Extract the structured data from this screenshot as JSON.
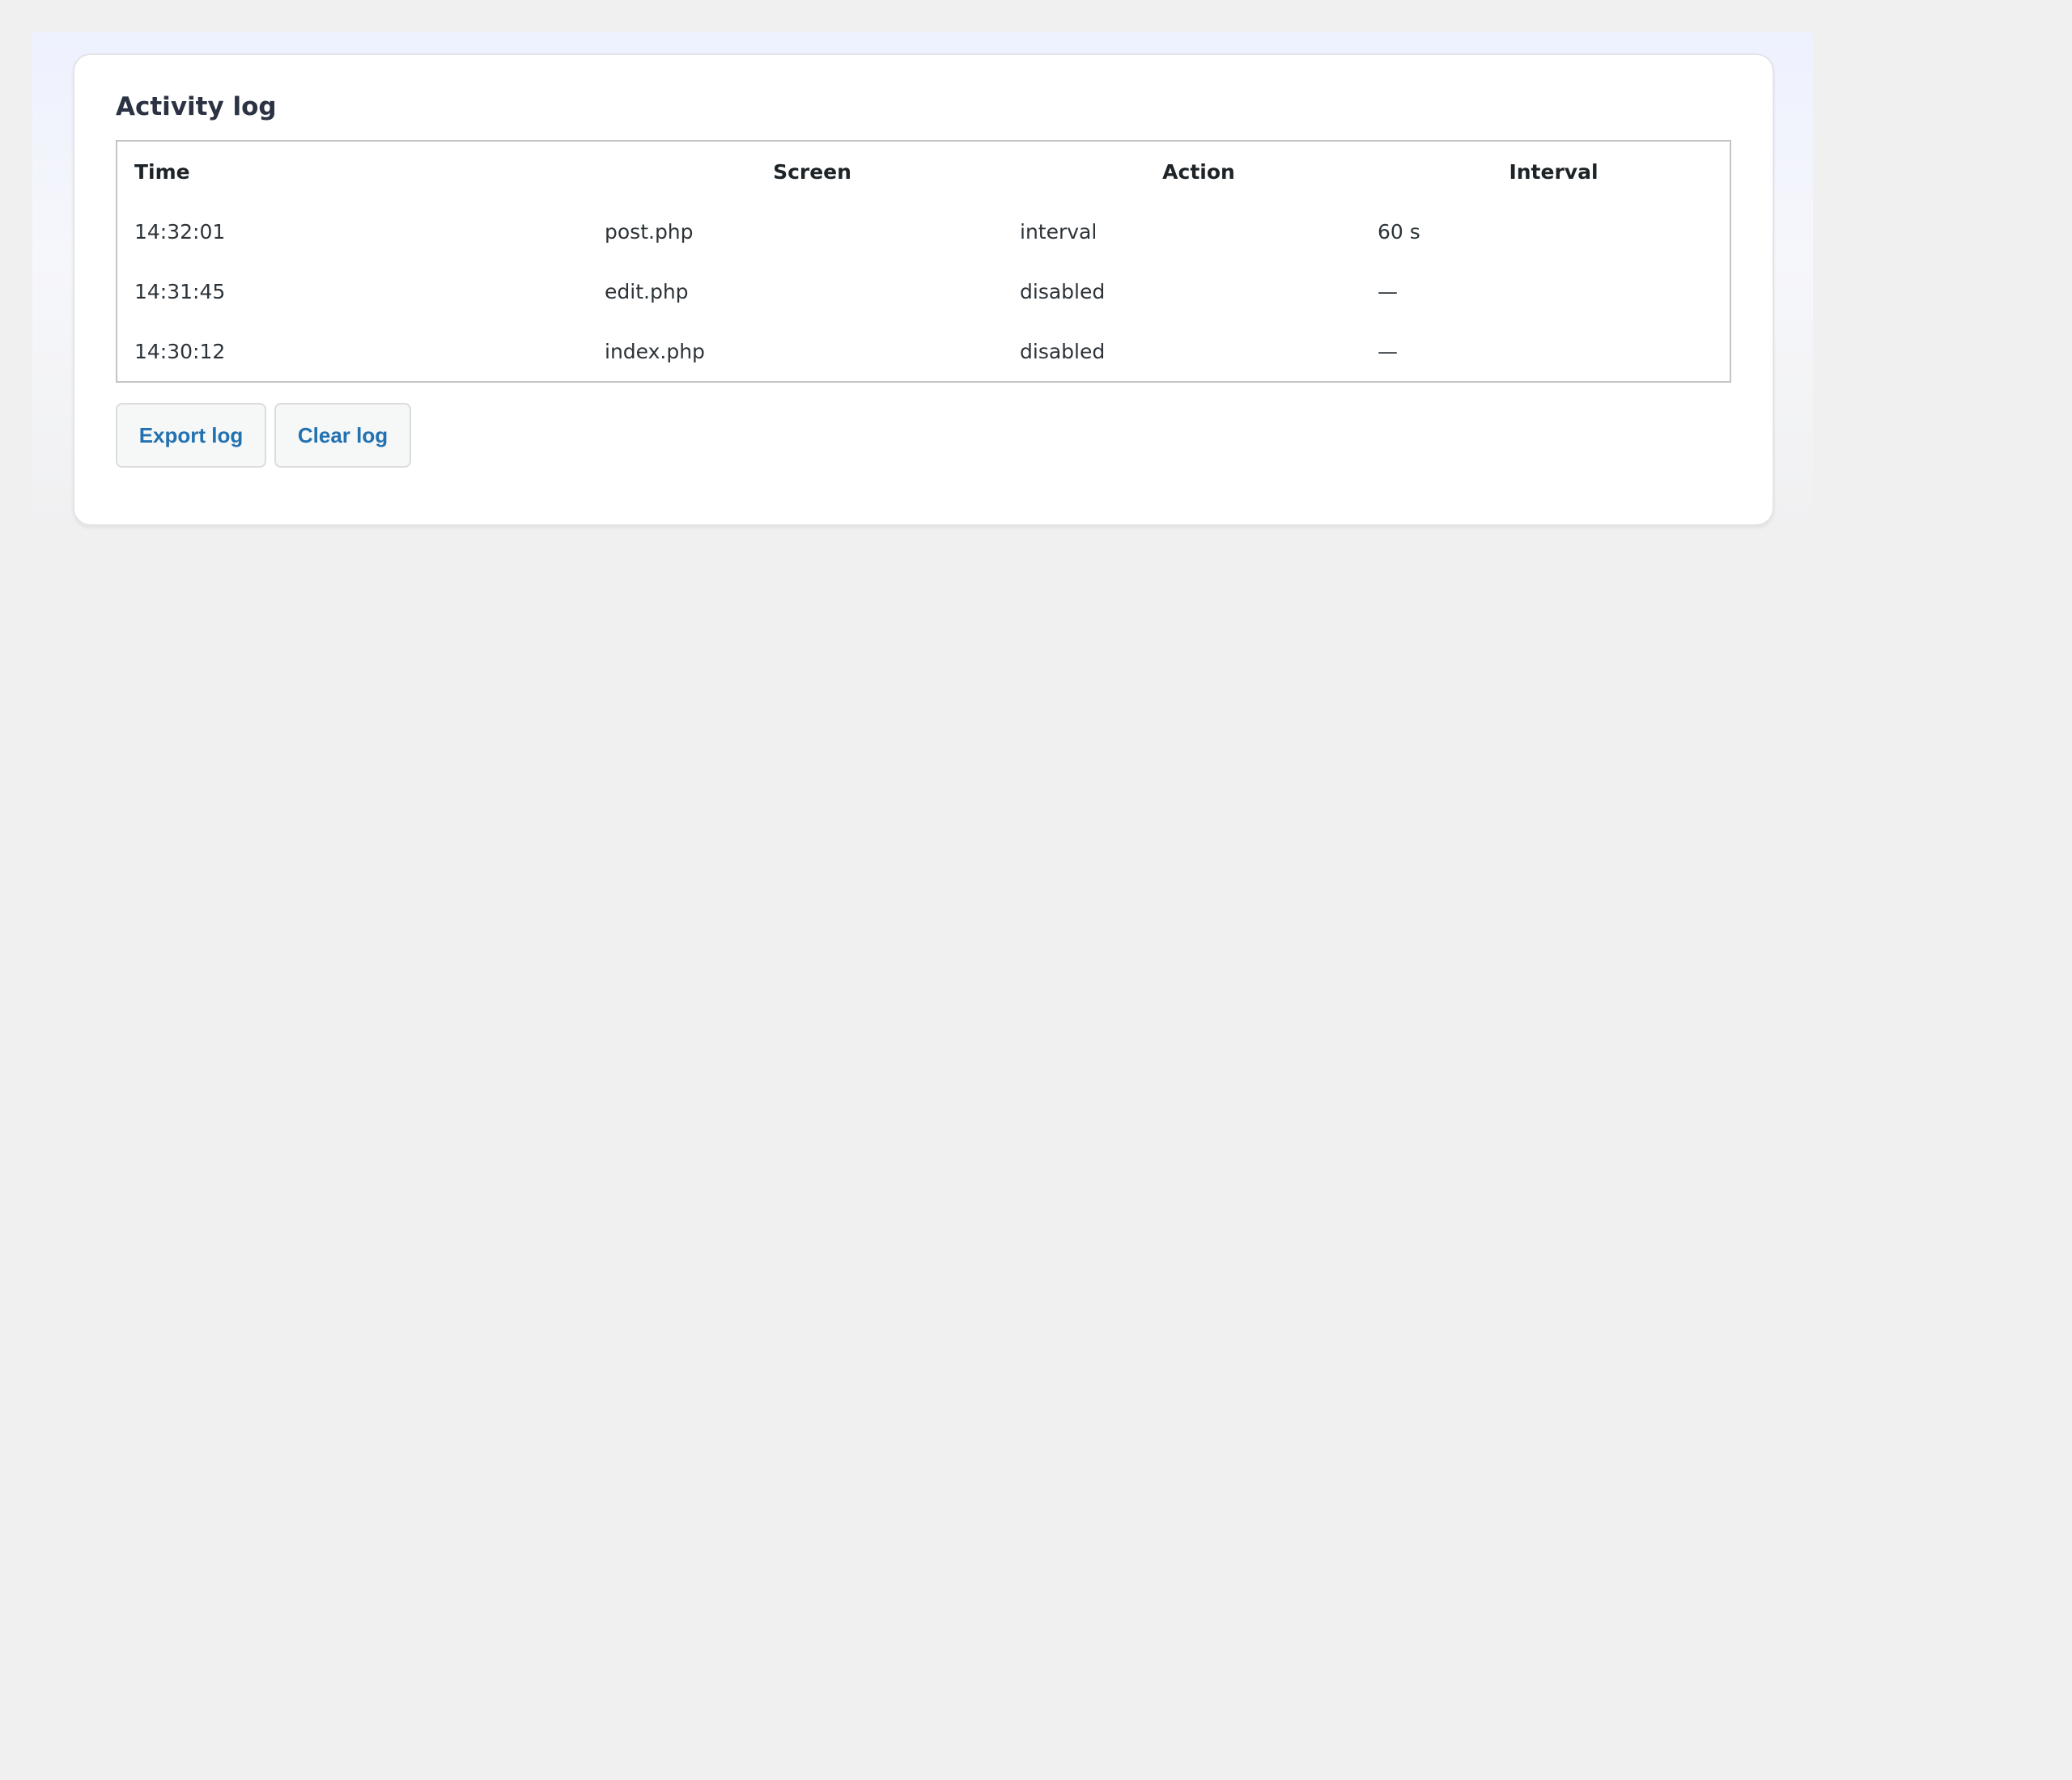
{
  "panel": {
    "title": "Activity log"
  },
  "table": {
    "headers": {
      "time": "Time",
      "screen": "Screen",
      "action": "Action",
      "interval": "Interval"
    },
    "rows": [
      {
        "time": "14:32:01",
        "screen": "post.php",
        "action": "interval",
        "interval": "60 s"
      },
      {
        "time": "14:31:45",
        "screen": "edit.php",
        "action": "disabled",
        "interval": "—"
      },
      {
        "time": "14:30:12",
        "screen": "index.php",
        "action": "disabled",
        "interval": "—"
      }
    ]
  },
  "buttons": {
    "export_label": "Export log",
    "clear_label": "Clear log"
  },
  "colors": {
    "page_background": "#f0f0f1",
    "card_background": "#ffffff",
    "button_text": "#2271b1",
    "title_text": "#2b3243"
  }
}
